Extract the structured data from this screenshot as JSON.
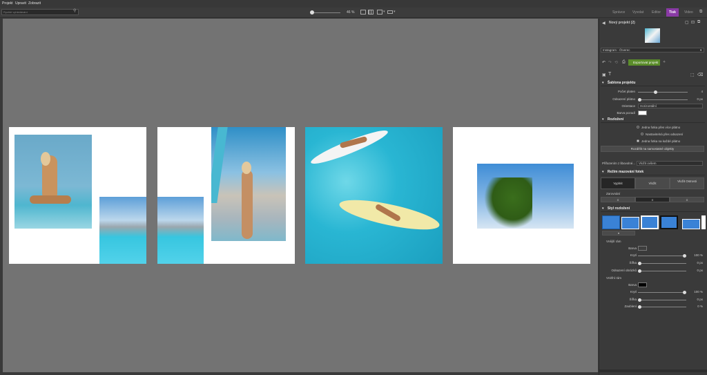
{
  "menu": {
    "items": [
      "Projekt",
      "Upravit",
      "Zobrazit"
    ]
  },
  "toolbar": {
    "search_placeholder": "Rychlé vyhledávání",
    "zoom_value": "46 %",
    "zoom_fraction": 0.06
  },
  "mode_tabs": [
    "Správce",
    "Vyvolat",
    "Editor",
    "Tisk",
    "Video"
  ],
  "active_tab": "Tisk",
  "panel": {
    "project_title": "Nový projekt (2)",
    "format_select": "Instagram - Čtverec",
    "export_label": "Exportovat projekt",
    "sections": {
      "template": "Šablona projektu",
      "layout": "Rozložení",
      "fill_mode": "Režim mazování fotek",
      "layout_style": "Styl rozložení"
    },
    "template": {
      "page_count_label": "Počet platen",
      "page_count_value": "4",
      "page_count_fraction": 0.35,
      "spacing_label": "Odsazení plátno",
      "spacing_value": "0 px",
      "spacing_fraction": 0.0,
      "orientation_label": "Orientace",
      "orientation_value": "Horizontální",
      "background_label": "Barva pozadí",
      "background_color": "#ffffff"
    },
    "layout": {
      "options": [
        "Jedna fotka přes více plátno",
        "Nastavitelná přes odsazení",
        "Jedna fotka na každé plátno"
      ],
      "selected_index": 2,
      "split_button": "Rozdělit na samostatné objekty"
    },
    "assign": {
      "label": "Přiřazením z libovolné...",
      "value": "Vložit ovšem"
    },
    "fill_mode": {
      "buttons": [
        "Vyplnit",
        "Vložit",
        "Vložit Ostrosti"
      ],
      "active_index": 0,
      "align_label": "Zarovnání"
    },
    "style": {
      "outer_label": "Vnější rám",
      "outer_color_label": "Barva",
      "outer_color": "#3e3e3e",
      "outer_opacity_label": "Krytí",
      "outer_opacity_value": "100 %",
      "outer_opacity_fraction": 1.0,
      "outer_width_label": "Šířka",
      "outer_width_value": "0 px",
      "outer_width_fraction": 0.0,
      "outer_radius_label": "Odsazení obrázků",
      "outer_radius_value": "0 px",
      "outer_radius_fraction": 0.0,
      "inner_label": "Vnitřní rám",
      "inner_color_label": "Barva",
      "inner_color": "#000000",
      "inner_opacity_label": "Krytí",
      "inner_opacity_value": "100 %",
      "inner_opacity_fraction": 1.0,
      "inner_width_label": "Šířka",
      "inner_width_value": "0 px",
      "inner_width_fraction": 0.0,
      "inner_blur_label": "Zaoblení",
      "inner_blur_value": "0 %",
      "inner_blur_fraction": 0.0
    }
  },
  "colors": {
    "accent": "#8a3aa6",
    "export_green": "#5b8d2a",
    "style_blue": "#3a82d6"
  }
}
